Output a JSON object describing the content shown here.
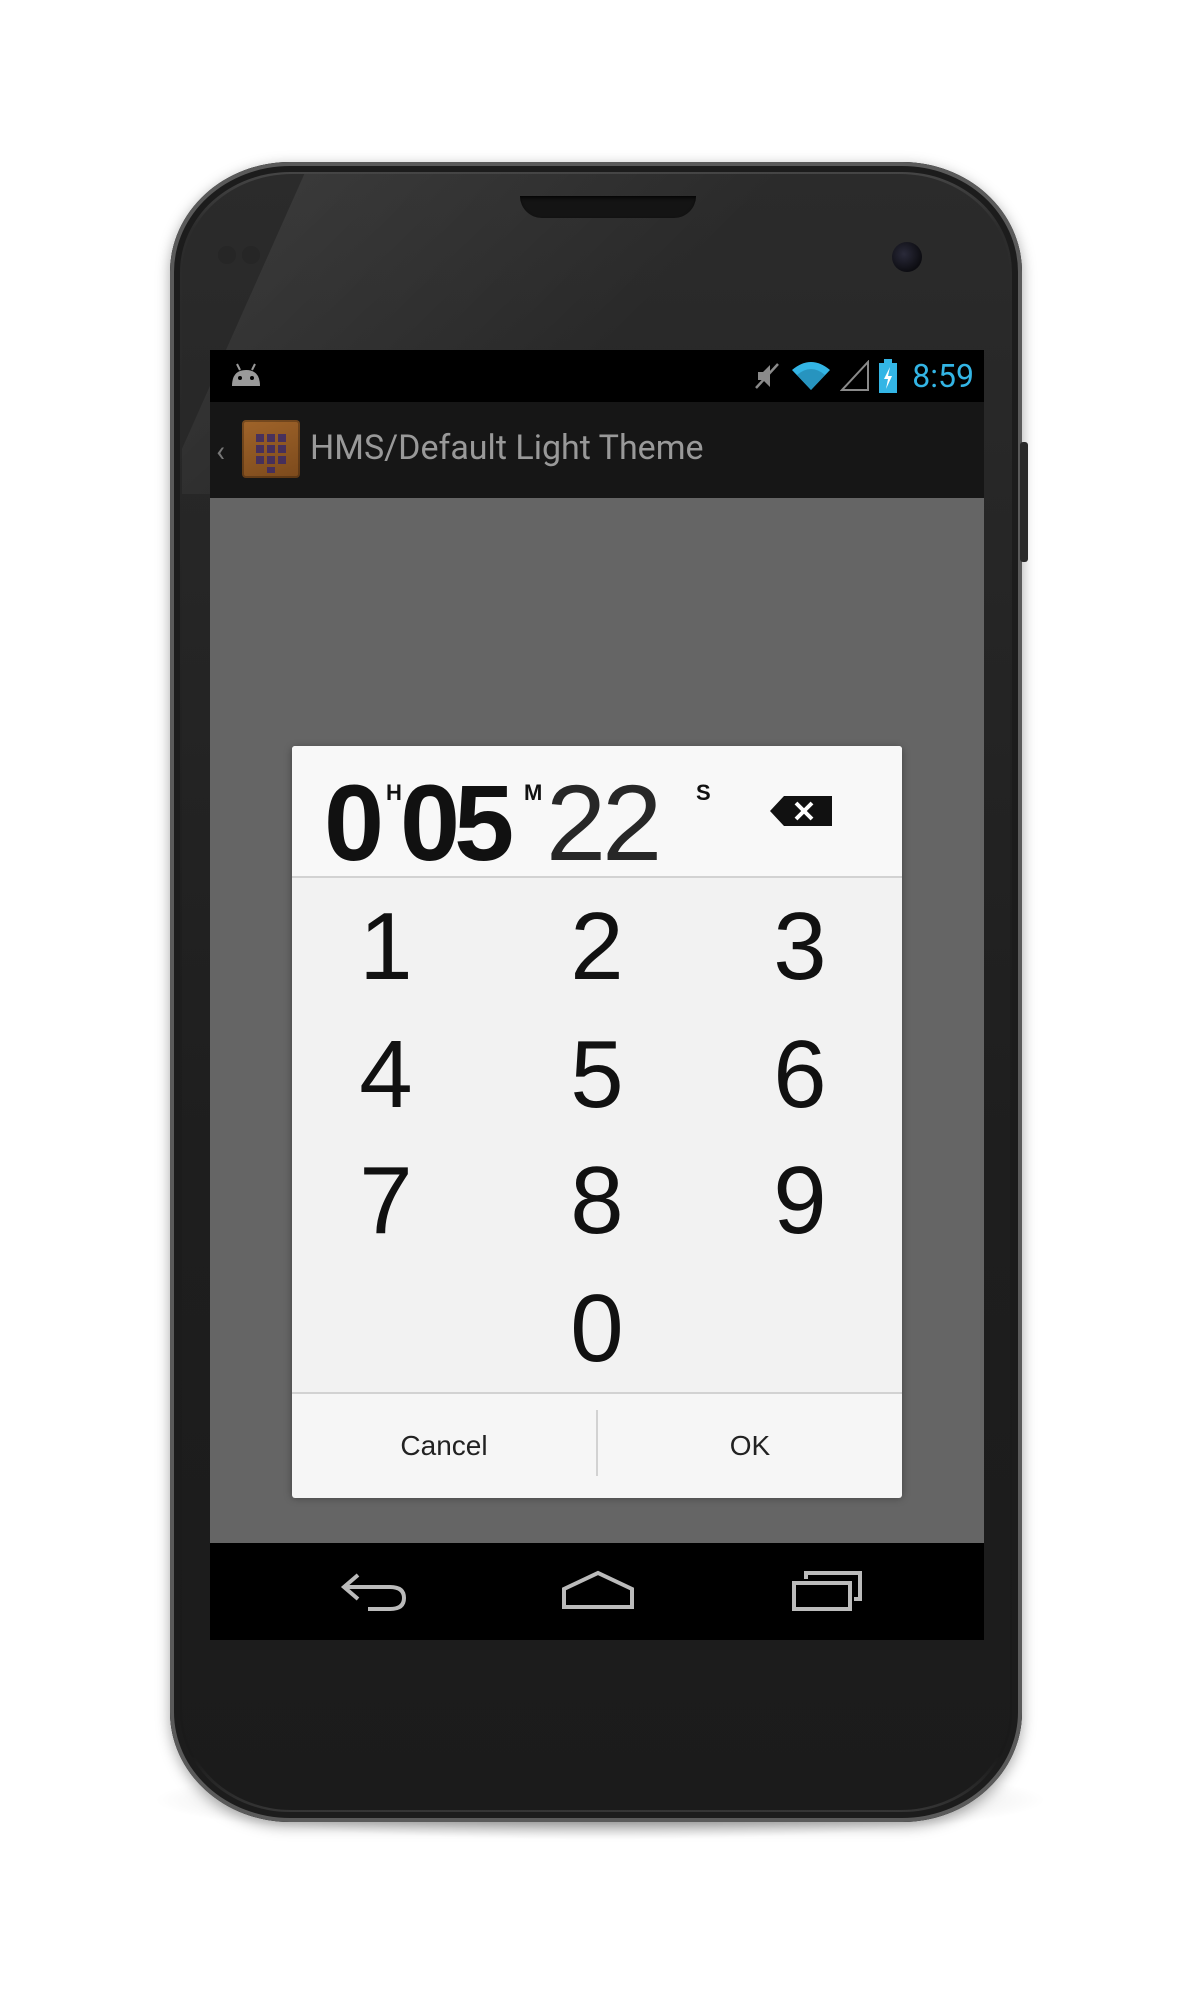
{
  "status_bar": {
    "time": "8:59",
    "icons": [
      "android-debug-icon",
      "mute-icon",
      "wifi-icon",
      "signal-icon",
      "battery-charging-icon"
    ],
    "accent_color": "#33b5e5"
  },
  "action_bar": {
    "title": "HMS/Default Light Theme"
  },
  "dialog": {
    "time_display": {
      "hours": "0",
      "hours_unit": "H",
      "minutes": "05",
      "minutes_unit": "M",
      "seconds": "22",
      "seconds_unit": "S"
    },
    "keypad": [
      "1",
      "2",
      "3",
      "4",
      "5",
      "6",
      "7",
      "8",
      "9",
      "0"
    ],
    "cancel_label": "Cancel",
    "ok_label": "OK"
  },
  "nav_bar": {
    "icons": [
      "back-icon",
      "home-icon",
      "recents-icon"
    ]
  }
}
